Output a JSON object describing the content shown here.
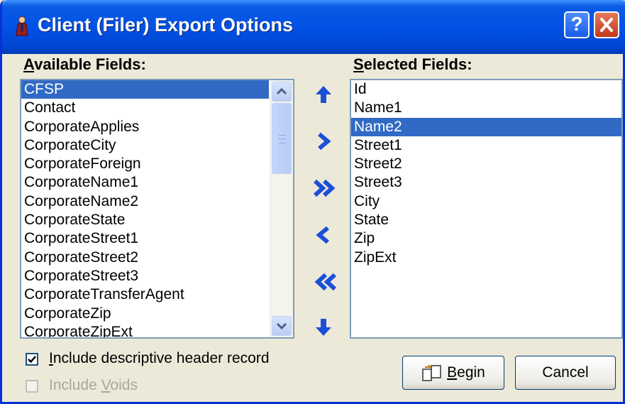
{
  "window": {
    "title": "Client (Filer) Export Options"
  },
  "title_buttons": {
    "help": "?",
    "close": "X"
  },
  "available": {
    "label_accel": "A",
    "label_rest": "vailable Fields:",
    "items": [
      "CFSP",
      "Contact",
      "CorporateApplies",
      "CorporateCity",
      "CorporateForeign",
      "CorporateName1",
      "CorporateName2",
      "CorporateState",
      "CorporateStreet1",
      "CorporateStreet2",
      "CorporateStreet3",
      "CorporateTransferAgent",
      "CorporateZip",
      "CorporateZipExt"
    ],
    "selected_index": 0
  },
  "selected": {
    "label_accel": "S",
    "label_rest": "elected Fields:",
    "items": [
      "Id",
      "Name1",
      "Name2",
      "Street1",
      "Street2",
      "Street3",
      "City",
      "State",
      "Zip",
      "ZipExt"
    ],
    "selected_index": 2
  },
  "options": {
    "include_header": {
      "pre": "",
      "accel": "I",
      "post": "nclude descriptive header record",
      "checked": true
    },
    "include_voids": {
      "pre": "Include ",
      "accel": "V",
      "post": "oids",
      "checked": false,
      "enabled": false
    }
  },
  "buttons": {
    "begin_accel": "B",
    "begin_rest": "egin",
    "cancel": "Cancel"
  },
  "colors": {
    "accent": "#316ac5",
    "arrow": "#1c4fd8",
    "titlebar": "#0152e6"
  }
}
